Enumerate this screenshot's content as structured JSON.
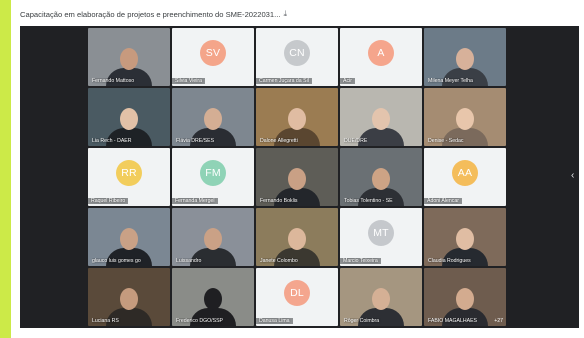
{
  "window": {
    "title": "Capacitação em elaboração de projetos e preenchimento do SME-2022031...",
    "download_icon": "download-icon"
  },
  "grid": {
    "extra_participants": "+27",
    "tiles": [
      {
        "name": "Fernando Mattoso",
        "type": "video",
        "bg": "#8a8f94",
        "skin": "#c79a7e",
        "shirt": "#2b2f36"
      },
      {
        "name": "Silvia Vieira",
        "type": "avatar",
        "initials": "SV",
        "color": "#f4a58a"
      },
      {
        "name": "Carmen Juçara da Sil",
        "type": "avatar",
        "initials": "CN",
        "color": "#c6c9cc"
      },
      {
        "name": "Acir",
        "type": "avatar",
        "initials": "A",
        "color": "#f5a58c"
      },
      {
        "name": "Milena Meyer Telha",
        "type": "video",
        "bg": "#6c7b88",
        "skin": "#d7b19a",
        "shirt": "#3a3f46"
      },
      {
        "name": "Lia Rech - DAER",
        "type": "video",
        "bg": "#4a5a62",
        "skin": "#e2c1a7",
        "shirt": "#1e2226"
      },
      {
        "name": "Flávia DRE/SES",
        "type": "video",
        "bg": "#7e8790",
        "skin": "#d4ae94",
        "shirt": "#2a2d33"
      },
      {
        "name": "Dalone Allegretti",
        "type": "video",
        "bg": "#9b7c52",
        "skin": "#e0bca2",
        "shirt": "#5a4630"
      },
      {
        "name": "DUE/DRE",
        "type": "video",
        "bg": "#b9b7b0",
        "skin": "#e3c4ad",
        "shirt": "#3b3e45"
      },
      {
        "name": "Denise - Sedac",
        "type": "video",
        "bg": "#a58c72",
        "skin": "#e8c6ab",
        "shirt": "#7b6a5c"
      },
      {
        "name": "Raquel Ribeiro",
        "type": "avatar",
        "initials": "RR",
        "color": "#f2cd5c"
      },
      {
        "name": "Fernanda Mergel",
        "type": "avatar",
        "initials": "FM",
        "color": "#8fd3b6"
      },
      {
        "name": "Fernando Boklis",
        "type": "video",
        "bg": "#5e5d57",
        "skin": "#c9a085",
        "shirt": "#23262b"
      },
      {
        "name": "Tobias Tolentino - SE",
        "type": "video",
        "bg": "#6a7074",
        "skin": "#cda385",
        "shirt": "#2d3035"
      },
      {
        "name": "Adoni Alencar",
        "type": "avatar",
        "initials": "AA",
        "color": "#f4bd5b"
      },
      {
        "name": "glauco luis gomes go",
        "type": "video",
        "bg": "#7b8793",
        "skin": "#c9a186",
        "shirt": "#1f2227"
      },
      {
        "name": "Luissandro",
        "type": "video",
        "bg": "#8a9099",
        "skin": "#caa186",
        "shirt": "#2a2d31"
      },
      {
        "name": "Janete Colombo",
        "type": "video",
        "bg": "#8c7c5c",
        "skin": "#dcb79b",
        "shirt": "#3b3830"
      },
      {
        "name": "Marcio Teixeira",
        "type": "avatar",
        "initials": "MT",
        "color": "#c5c8cc"
      },
      {
        "name": "Claudia Rodrigues",
        "type": "video",
        "bg": "#7e6a5a",
        "skin": "#e0bda3",
        "shirt": "#262a30"
      },
      {
        "name": "Luciana RS",
        "type": "video",
        "bg": "#5a4a3a",
        "skin": "#c59b7e",
        "shirt": "#2e2a26"
      },
      {
        "name": "Frederico DGO/SSP",
        "type": "video",
        "bg": "#8a8c88",
        "skin": "#1f1f22",
        "shirt": "#1f1f22"
      },
      {
        "name": "Danusa Lima",
        "type": "avatar",
        "initials": "DL",
        "color": "#f4a68e"
      },
      {
        "name": "Rôger Coimbra",
        "type": "video",
        "bg": "#a59680",
        "skin": "#d5b095",
        "shirt": "#2d2f34"
      },
      {
        "name": "FABIO MAGALHAES",
        "type": "video",
        "bg": "#6e5c4e",
        "skin": "#d3ab8f",
        "shirt": "#2a2b30"
      }
    ]
  }
}
